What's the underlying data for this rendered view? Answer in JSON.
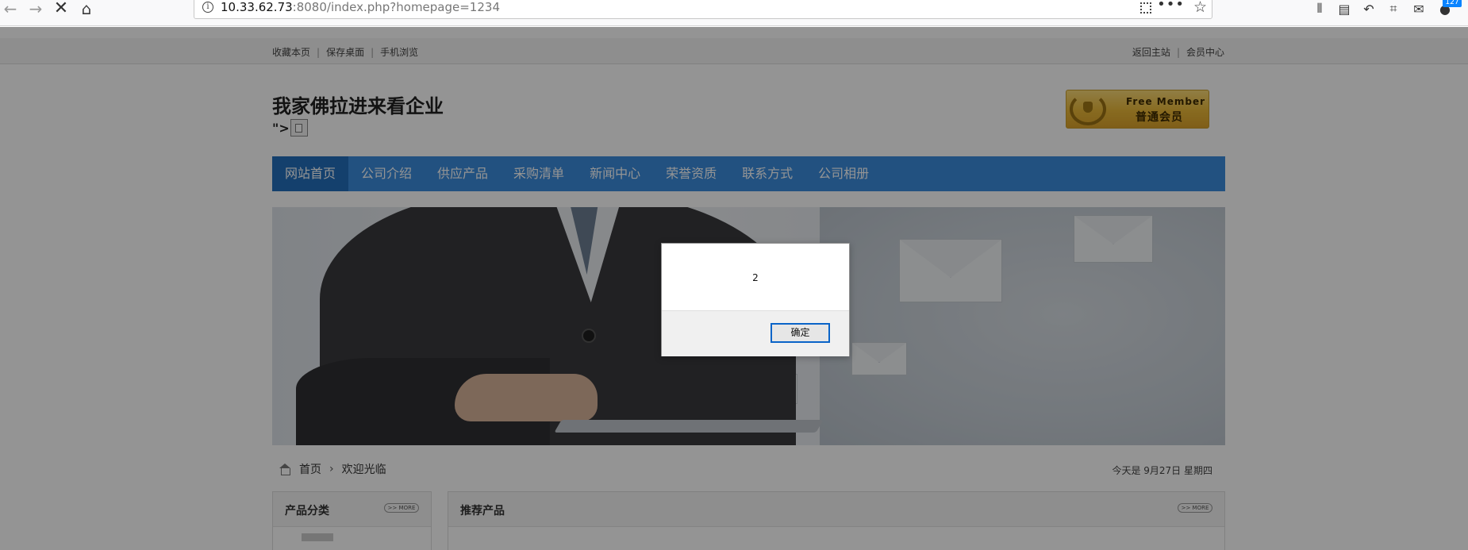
{
  "browser": {
    "url_host": "10.33.62.73",
    "url_rest": ":8080/index.php?homepage=1234",
    "badge": "127",
    "stray_text": "\">"
  },
  "topbar": {
    "left_links": [
      "收藏本页",
      "保存桌面",
      "手机浏览"
    ],
    "right_links": [
      "返回主站",
      "会员中心"
    ]
  },
  "header": {
    "site_title": "我家佛拉进来看企业",
    "broken_text": "\">",
    "member_en": "Free Member",
    "member_cn": "普通会员"
  },
  "nav": {
    "items": [
      "网站首页",
      "公司介绍",
      "供应产品",
      "采购清单",
      "新闻中心",
      "荣誉资质",
      "联系方式",
      "公司相册"
    ],
    "active_index": 0
  },
  "breadcrumb": {
    "home": "首页",
    "arrow": "›",
    "current": "欢迎光临"
  },
  "date_text": "今天是 9月27日 星期四",
  "panels": {
    "left_title": "产品分类",
    "right_title": "推荐产品",
    "more_label": ">> MORE"
  },
  "dialog": {
    "message": "2",
    "ok_label": "确定"
  },
  "colors": {
    "nav_bg": "#3b8cdc",
    "nav_active": "#236fbc",
    "dialog_focus": "#0a64c8"
  }
}
